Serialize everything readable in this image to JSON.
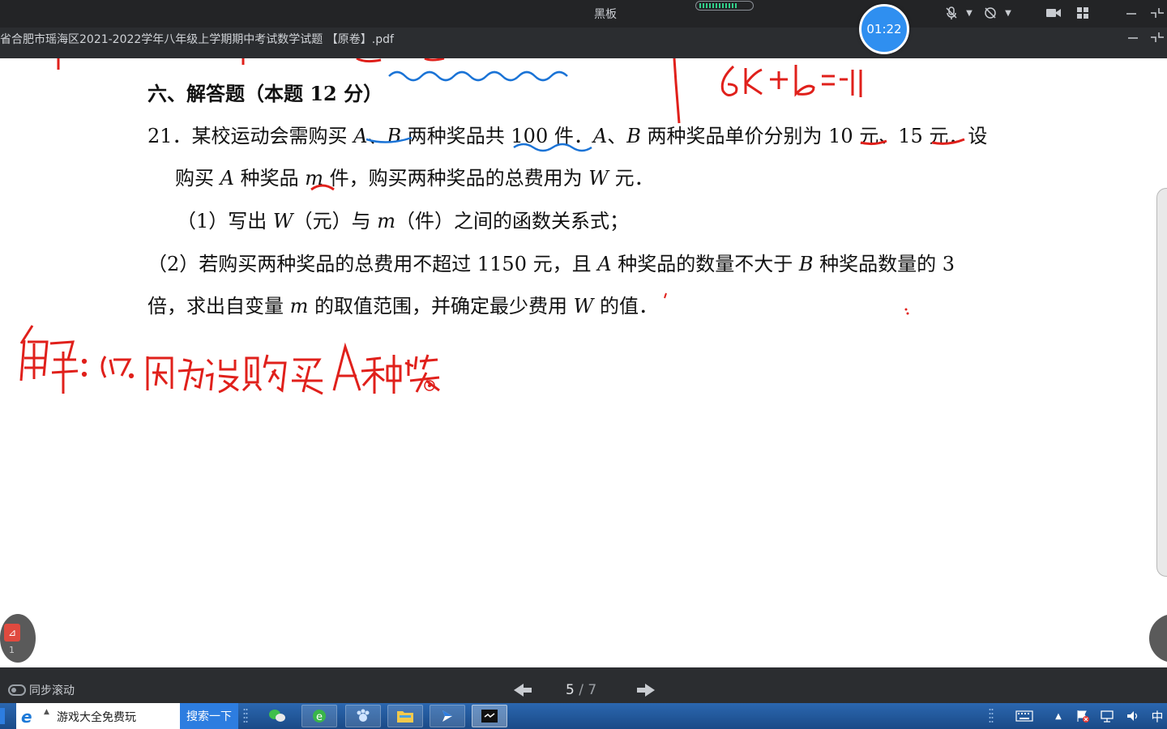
{
  "window": {
    "title": "黑板",
    "doc_title": "省合肥市瑶海区2021-2022学年八年级上学期期中考试数学试题 【原卷】.pdf",
    "timer": "01:22"
  },
  "icons": [
    "mic-muted-icon",
    "camera-muted-icon",
    "video-icon",
    "grid-icon",
    "minimize-icon",
    "collapse-icon"
  ],
  "content": {
    "section_heading": "六、解答题（本题 12 分）",
    "q21_line1": {
      "num": "21．某校运动会需购买 ",
      "a": "A",
      "sep1": "、",
      "b": "B",
      "rest": " 两种奖品共 100 件．",
      "a2": "A",
      "sep2": "、",
      "b2": "B",
      "rest2": " 两种奖品单价分别为 10 元、15 元．设"
    },
    "q21_line2": {
      "pre": "购买 ",
      "a": "A",
      "mid": " 种奖品 ",
      "m": "m",
      "post": " 件，购买两种奖品的总费用为 ",
      "w": "W",
      "end": " 元．"
    },
    "part1": {
      "pre": "（1）写出 ",
      "w": "W",
      "mid": "（元）与 ",
      "m": "m",
      "post": "（件）之间的函数关系式；"
    },
    "part2_line1": {
      "pre": "（2）若购买两种奖品的总费用不超过 1150 元，且 ",
      "a": "A",
      "mid": " 种奖品的数量不大于 ",
      "b": "B",
      "post": " 种奖品数量的 3"
    },
    "part2_line2": {
      "pre": "倍，求出自变量 ",
      "m": "m",
      "mid": " 的取值范围，并确定最少费用 ",
      "w": "W",
      "post": " 的值．"
    },
    "ink_top_right": "6k+b=-11",
    "ink_answer": "解：(1). 因为设购买A种奖"
  },
  "floating": {
    "pdf_badge": "1"
  },
  "bottom": {
    "sync_label": "同步滚动",
    "page_current": "5",
    "page_sep": " / ",
    "page_total": "7"
  },
  "taskbar": {
    "browser_search_text": "游戏大全免费玩",
    "search_button": "搜索一下",
    "ime": "中"
  },
  "colors": {
    "ink_red": "#e0201b",
    "ink_blue": "#1a73d6",
    "timer_blue": "#2f8ff0",
    "taskbar_blue": "#1f57a0"
  }
}
